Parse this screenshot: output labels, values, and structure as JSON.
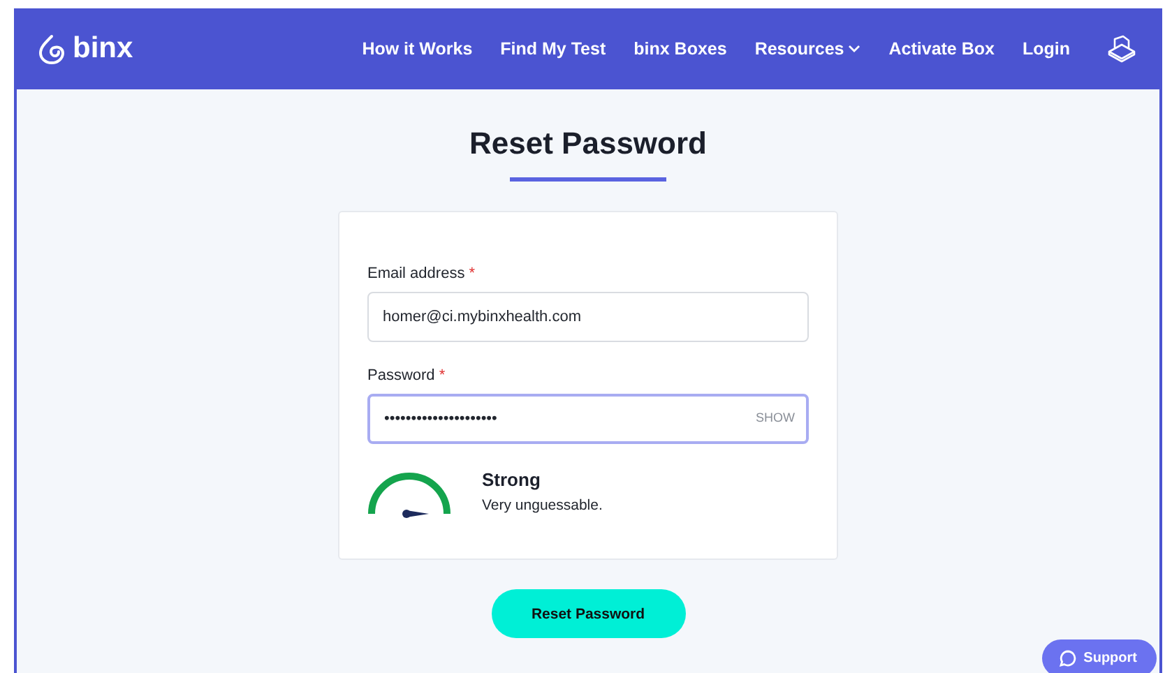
{
  "header": {
    "logo": "binx",
    "nav": [
      {
        "label": "How it Works",
        "kind": "link"
      },
      {
        "label": "Find My Test",
        "kind": "link"
      },
      {
        "label": "binx Boxes",
        "kind": "link"
      },
      {
        "label": "Resources",
        "kind": "dropdown"
      },
      {
        "label": "Activate Box",
        "kind": "link"
      },
      {
        "label": "Login",
        "kind": "link"
      }
    ]
  },
  "title": "Reset Password",
  "form": {
    "fields": [
      {
        "label": "Email address",
        "required_mark": "*",
        "value": "homer@ci.mybinxhealth.com",
        "focused": false
      },
      {
        "label": "Password",
        "required_mark": "*",
        "value": "•••••••••••••••••••••",
        "focused": true,
        "toggle": "SHOW"
      }
    ],
    "strength": {
      "level": 1,
      "label": "Strong",
      "description": "Very unguessable."
    }
  },
  "submit": "Reset Password",
  "support": "Support"
}
